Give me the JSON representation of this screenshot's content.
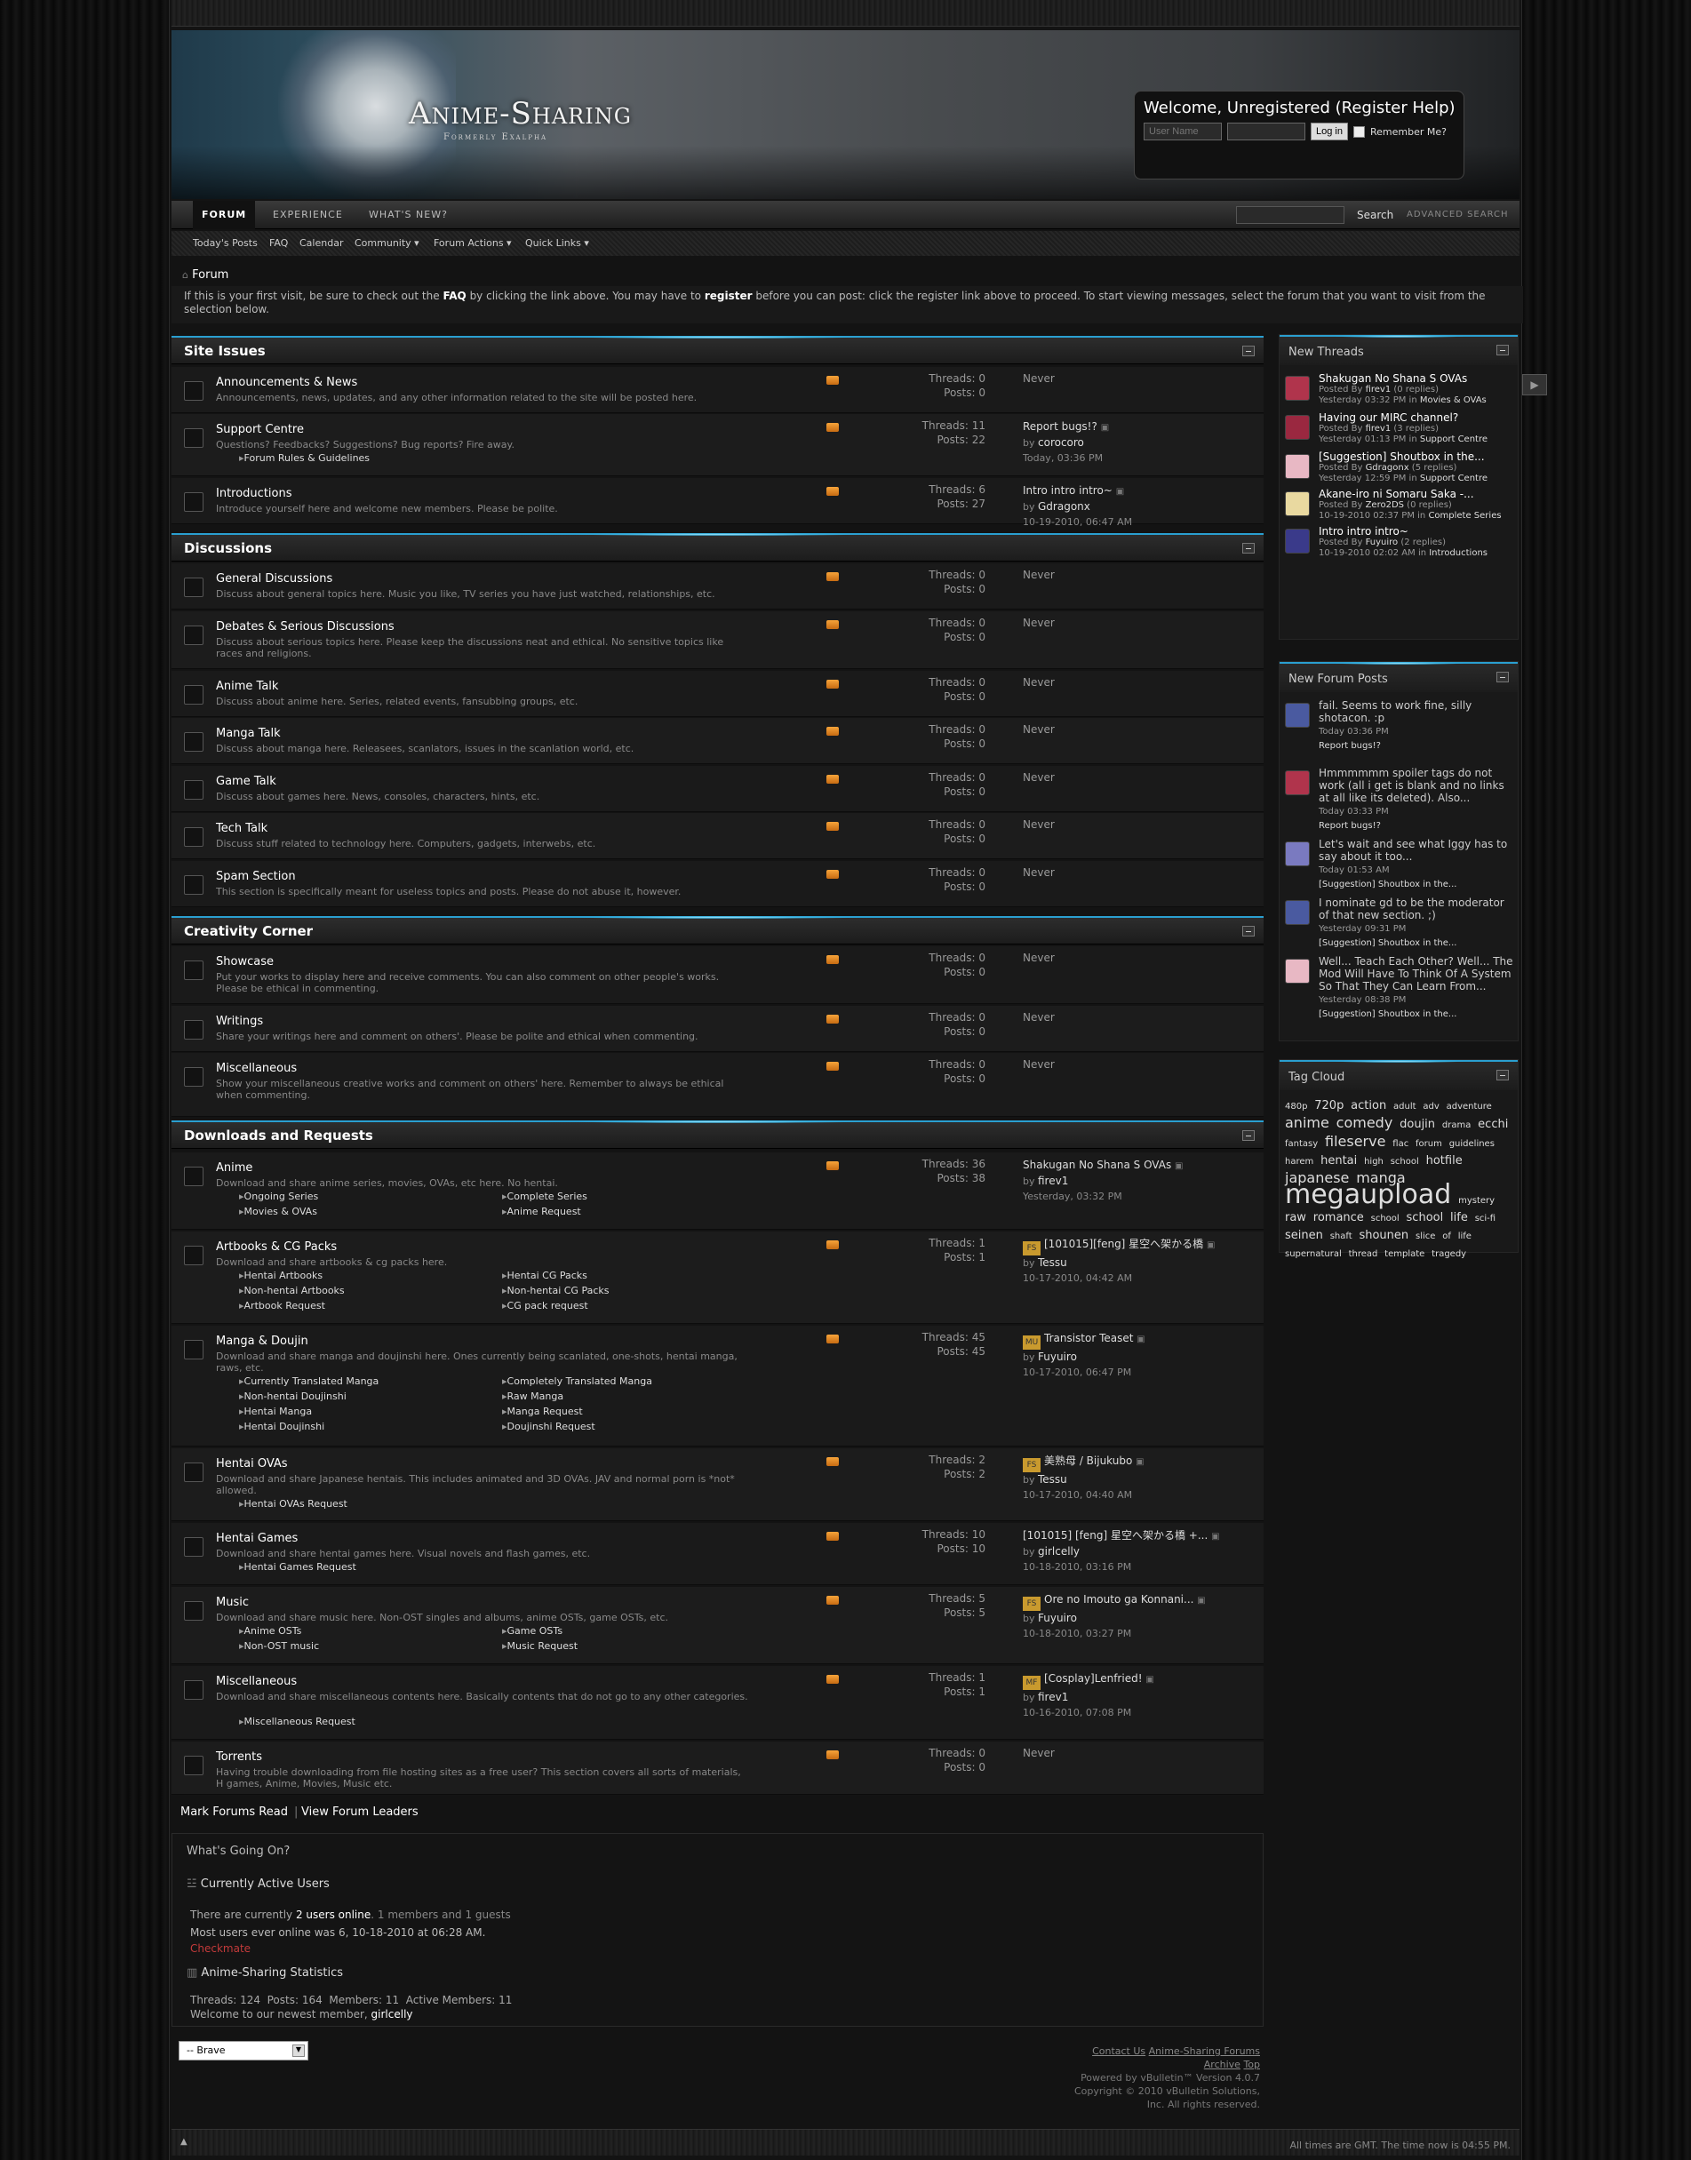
{
  "site": {
    "logo": "Anime-Sharing",
    "tagline": "Formerly Exalpha"
  },
  "login": {
    "welcome": "Welcome, Unregistered (Register Help)",
    "username_placeholder": "User Name",
    "login_button": "Log in",
    "remember": "Remember Me?"
  },
  "nav": {
    "tabs": [
      "FORUM",
      "EXPERIENCE",
      "WHAT'S NEW?"
    ],
    "search_button": "Search",
    "advanced": "ADVANCED SEARCH"
  },
  "subnav": [
    "Today's Posts",
    "FAQ",
    "Calendar",
    "Community ▾",
    "Forum Actions ▾",
    "Quick Links ▾"
  ],
  "breadcrumb": "Forum",
  "notice": {
    "p1": "If this is your first visit, be sure to check out the ",
    "faq": "FAQ",
    "p2": " by clicking the link above. You may have to ",
    "register": "register",
    "p3": " before you can post: click the register link above to proceed. To start viewing messages, select the forum that you want to visit from the selection below."
  },
  "categories": [
    {
      "title": "Site Issues",
      "forums": [
        {
          "name": "Announcements & News",
          "desc": "Announcements, news, updates, and any other information related to the site will be posted here.",
          "threads": "Threads: 0",
          "posts": "Posts: 0",
          "last": "Never"
        },
        {
          "name": "Support Centre",
          "desc": "Questions? Feedbacks? Suggestions? Bug reports? Fire away.",
          "subs": [
            "Forum Rules & Guidelines"
          ],
          "threads": "Threads: 11",
          "posts": "Posts: 22",
          "last_title": "Report bugs!?",
          "last_by": "corocoro",
          "last_time": "Today, 03:36 PM"
        },
        {
          "name": "Introductions",
          "desc": "Introduce yourself here and welcome new members. Please be polite.",
          "threads": "Threads: 6",
          "posts": "Posts: 27",
          "last_title": "Intro intro intro~",
          "last_by": "Gdragonx",
          "last_time": "10-19-2010, 06:47 AM"
        }
      ]
    },
    {
      "title": "Discussions",
      "forums": [
        {
          "name": "General Discussions",
          "desc": "Discuss about general topics here. Music you like, TV series you have just watched, relationships, etc.",
          "threads": "Threads: 0",
          "posts": "Posts: 0",
          "last": "Never"
        },
        {
          "name": "Debates & Serious Discussions",
          "desc": "Discuss about serious topics here. Please keep the discussions neat and ethical. No sensitive topics like races and religions.",
          "threads": "Threads: 0",
          "posts": "Posts: 0",
          "last": "Never"
        },
        {
          "name": "Anime Talk",
          "desc": "Discuss about anime here. Series, related events, fansubbing groups, etc.",
          "threads": "Threads: 0",
          "posts": "Posts: 0",
          "last": "Never"
        },
        {
          "name": "Manga Talk",
          "desc": "Discuss about manga here. Releasees, scanlators, issues in the scanlation world, etc.",
          "threads": "Threads: 0",
          "posts": "Posts: 0",
          "last": "Never"
        },
        {
          "name": "Game Talk",
          "desc": "Discuss about games here. News, consoles, characters, hints, etc.",
          "threads": "Threads: 0",
          "posts": "Posts: 0",
          "last": "Never"
        },
        {
          "name": "Tech Talk",
          "desc": "Discuss stuff related to technology here. Computers, gadgets, interwebs, etc.",
          "threads": "Threads: 0",
          "posts": "Posts: 0",
          "last": "Never"
        },
        {
          "name": "Spam Section",
          "desc": "This section is specifically meant for useless topics and posts. Please do not abuse it, however.",
          "threads": "Threads: 0",
          "posts": "Posts: 0",
          "last": "Never"
        }
      ]
    },
    {
      "title": "Creativity Corner",
      "forums": [
        {
          "name": "Showcase",
          "desc": "Put your works to display here and receive comments. You can also comment on other people's works. Please be ethical in commenting.",
          "threads": "Threads: 0",
          "posts": "Posts: 0",
          "last": "Never"
        },
        {
          "name": "Writings",
          "desc": "Share your writings here and comment on others'. Please be polite and ethical when commenting.",
          "threads": "Threads: 0",
          "posts": "Posts: 0",
          "last": "Never"
        },
        {
          "name": "Miscellaneous",
          "desc": "Show your miscellaneous creative works and comment on others' here. Remember to always be ethical when commenting.",
          "threads": "Threads: 0",
          "posts": "Posts: 0",
          "last": "Never"
        }
      ]
    },
    {
      "title": "Downloads and Requests",
      "forums": [
        {
          "name": "Anime",
          "desc": "Download and share anime series, movies, OVAs, etc here. No hentai.",
          "subs": [
            "Ongoing Series",
            "Complete Series",
            "Movies & OVAs",
            "Anime Request"
          ],
          "threads": "Threads: 36",
          "posts": "Posts: 38",
          "last_title": "Shakugan No Shana S OVAs",
          "last_by": "firev1",
          "last_time": "Yesterday, 03:32 PM"
        },
        {
          "name": "Artbooks & CG Packs",
          "desc": "Download and share artbooks & cg packs here.",
          "subs": [
            "Hentai Artbooks",
            "Hentai CG Packs",
            "Non-hentai Artbooks",
            "Non-hentai CG Packs",
            "Artbook Request",
            "CG pack request"
          ],
          "threads": "Threads: 1",
          "posts": "Posts: 1",
          "last_tag": "FS",
          "last_title": "[101015][feng] 星空へ架かる橋",
          "last_by": "Tessu",
          "last_time": "10-17-2010, 04:42 AM"
        },
        {
          "name": "Manga & Doujin",
          "desc": "Download and share manga and doujinshi here. Ones currently being scanlated, one-shots, hentai manga, raws, etc.",
          "subs": [
            "Currently Translated Manga",
            "Completely Translated Manga",
            "Non-hentai Doujinshi",
            "Raw Manga",
            "Hentai Manga",
            "Manga Request",
            "Hentai Doujinshi",
            "Doujinshi Request"
          ],
          "threads": "Threads: 45",
          "posts": "Posts: 45",
          "last_tag": "MU",
          "last_title": "Transistor Teaset",
          "last_by": "Fuyuiro",
          "last_time": "10-17-2010, 06:47 PM"
        },
        {
          "name": "Hentai OVAs",
          "desc": "Download and share Japanese hentais. This includes animated and 3D OVAs. JAV and normal porn is *not* allowed.",
          "subs": [
            "Hentai OVAs Request"
          ],
          "threads": "Threads: 2",
          "posts": "Posts: 2",
          "last_tag": "FS",
          "last_title": "美熟母 / Bijukubo",
          "last_by": "Tessu",
          "last_time": "10-17-2010, 04:40 AM"
        },
        {
          "name": "Hentai Games",
          "desc": "Download and share hentai games here. Visual novels and flash games, etc.",
          "subs": [
            "Hentai Games Request"
          ],
          "threads": "Threads: 10",
          "posts": "Posts: 10",
          "last_title": "[101015] [feng] 星空へ架かる橋 +...",
          "last_by": "girlcelly",
          "last_time": "10-18-2010, 03:16 PM"
        },
        {
          "name": "Music",
          "desc": "Download and share music here. Non-OST singles and albums, anime OSTs, game OSTs, etc.",
          "subs": [
            "Anime OSTs",
            "Game OSTs",
            "Non-OST music",
            "Music Request"
          ],
          "threads": "Threads: 5",
          "posts": "Posts: 5",
          "last_tag": "FS",
          "last_title": "Ore no Imouto ga Konnani...",
          "last_by": "Fuyuiro",
          "last_time": "10-18-2010, 03:27 PM"
        },
        {
          "name": "Miscellaneous",
          "desc": "Download and share miscellaneous contents here. Basically contents that do not go to any other categories.",
          "subs": [
            "Miscellaneous Request"
          ],
          "threads": "Threads: 1",
          "posts": "Posts: 1",
          "last_tag": "MF",
          "last_title": "[Cosplay]Lenfried!",
          "last_by": "firev1",
          "last_time": "10-16-2010, 07:08 PM"
        },
        {
          "name": "Torrents",
          "desc": "Having trouble downloading from file hosting sites as a free user? This section covers all sorts of materials, H games, Anime, Movies, Music etc.",
          "threads": "Threads: 0",
          "posts": "Posts: 0",
          "last": "Never"
        }
      ]
    }
  ],
  "by_prefix": "by ",
  "bottom_links": {
    "mark": "Mark Forums Read",
    "sep": "|",
    "leaders": "View Forum Leaders"
  },
  "wgo": {
    "title": "What's Going On?",
    "active_title": "Currently Active Users",
    "active_pre": "There are currently ",
    "active_count": "2 users online",
    "active_post": ". 1 members and 1 guests",
    "most": "Most users ever online was 6, 10-18-2010 at 06:28 AM.",
    "member": "Checkmate",
    "stats_title": "Anime-Sharing Statistics",
    "stats": "Threads: 124  Posts: 164  Members: 11  Active Members: 11",
    "newest_pre": "Welcome to our newest member, ",
    "newest": "girlcelly"
  },
  "style_select": "-- Brave",
  "footer": {
    "links": [
      "Contact Us",
      "Anime-Sharing Forums",
      "Archive",
      "Top"
    ],
    "powered": "Powered by vBulletin™ Version 4.0.7",
    "copyright": "Copyright © 2010 vBulletin Solutions, Inc. All rights reserved."
  },
  "time": "All times are GMT. The time now is 04:55 PM.",
  "new_threads": {
    "title": "New Threads",
    "items": [
      {
        "title": "Shakugan No Shana S OVAs",
        "pre": "Posted By ",
        "user": "firev1",
        "replies": " (0 replies)",
        "when": "Yesterday 03:32 PM in ",
        "forum": "Movies & OVAs"
      },
      {
        "title": "Having our MIRC channel?",
        "pre": "Posted By ",
        "user": "firev1",
        "replies": " (3 replies)",
        "when": "Yesterday 01:13 PM in ",
        "forum": "Support Centre"
      },
      {
        "title": "[Suggestion] Shoutbox in the...",
        "pre": "Posted By ",
        "user": "Gdragonx",
        "replies": " (5 replies)",
        "when": "Yesterday 12:59 PM in ",
        "forum": "Support Centre"
      },
      {
        "title": "Akane-iro ni Somaru Saka -...",
        "pre": "Posted By ",
        "user": "Zero2DS",
        "replies": " (0 replies)",
        "when": "10-19-2010 02:37 PM in ",
        "forum": "Complete Series"
      },
      {
        "title": "Intro intro intro~",
        "pre": "Posted By ",
        "user": "Fuyuiro",
        "replies": " (2 replies)",
        "when": "10-19-2010 02:02 AM in ",
        "forum": "Introductions"
      }
    ]
  },
  "new_posts": {
    "title": "New Forum Posts",
    "items": [
      {
        "text": "fail. Seems to work fine, silly shotacon. :p",
        "when": "Today 03:36 PM",
        "thread": "Report bugs!?"
      },
      {
        "text": "Hmmmmmm spoiler tags do not work (all i get is blank and no links at all like its deleted). Also...",
        "when": "Today 03:33 PM",
        "thread": "Report bugs!?"
      },
      {
        "text": "Let's wait and see what Iggy has to say about it too...",
        "when": "Today 01:53 AM",
        "thread": "[Suggestion] Shoutbox in the..."
      },
      {
        "text": "I nominate gd to be the moderator of that new section. ;)",
        "when": "Yesterday 09:31 PM",
        "thread": "[Suggestion] Shoutbox in the..."
      },
      {
        "text": "Well... Teach Each Other? Well... The Mod Will Have To Think Of A System So That They Can Learn From...",
        "when": "Yesterday 08:38 PM",
        "thread": "[Suggestion] Shoutbox in the..."
      }
    ]
  },
  "tag_cloud": {
    "title": "Tag Cloud",
    "tags": [
      {
        "t": "480p",
        "s": 1
      },
      {
        "t": "720p",
        "s": 2
      },
      {
        "t": "action",
        "s": 2
      },
      {
        "t": "adult",
        "s": 1
      },
      {
        "t": "adv",
        "s": 1
      },
      {
        "t": "adventure",
        "s": 1
      },
      {
        "t": "anime",
        "s": 3
      },
      {
        "t": "comedy",
        "s": 3
      },
      {
        "t": "doujin",
        "s": 2
      },
      {
        "t": "drama",
        "s": 1
      },
      {
        "t": "ecchi",
        "s": 2
      },
      {
        "t": "fantasy",
        "s": 1
      },
      {
        "t": "fileserve",
        "s": 3
      },
      {
        "t": "flac",
        "s": 1
      },
      {
        "t": "forum",
        "s": 1
      },
      {
        "t": "guidelines",
        "s": 1
      },
      {
        "t": "harem",
        "s": 1
      },
      {
        "t": "hentai",
        "s": 2
      },
      {
        "t": "high",
        "s": 1
      },
      {
        "t": "school",
        "s": 1
      },
      {
        "t": "hotfile",
        "s": 2
      },
      {
        "t": "japanese",
        "s": 3
      },
      {
        "t": "manga",
        "s": 3
      },
      {
        "t": "megaupload",
        "s": 5
      },
      {
        "t": "mystery",
        "s": 1
      },
      {
        "t": "raw",
        "s": 2
      },
      {
        "t": "romance",
        "s": 2
      },
      {
        "t": "school",
        "s": 1
      },
      {
        "t": "school",
        "s": 2
      },
      {
        "t": "life",
        "s": 2
      },
      {
        "t": "sci-fi",
        "s": 1
      },
      {
        "t": "seinen",
        "s": 2
      },
      {
        "t": "shaft",
        "s": 1
      },
      {
        "t": "shounen",
        "s": 2
      },
      {
        "t": "slice",
        "s": 1
      },
      {
        "t": "of",
        "s": 1
      },
      {
        "t": "life",
        "s": 1
      },
      {
        "t": "supernatural",
        "s": 1
      },
      {
        "t": "thread",
        "s": 1
      },
      {
        "t": "template",
        "s": 1
      },
      {
        "t": "tragedy",
        "s": 1
      }
    ]
  }
}
